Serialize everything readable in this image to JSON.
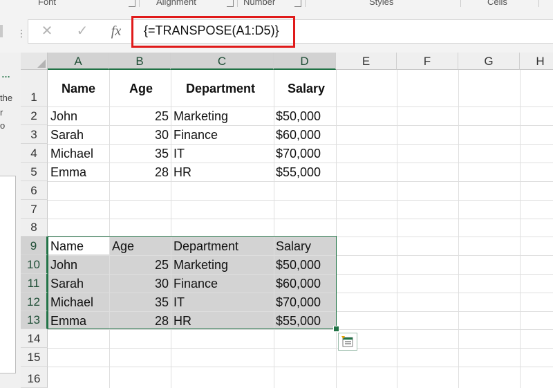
{
  "ribbon": {
    "groups": [
      "Font",
      "Alignment",
      "Number",
      "Styles",
      "Cells"
    ],
    "launcher_icon": "dialog-launcher-icon"
  },
  "formula_bar": {
    "cancel_icon": "✕",
    "enter_icon": "✓",
    "function_label": "fx",
    "formula": "{=TRANSPOSE(A1:D5)}",
    "highlight_color": "#e01a1a"
  },
  "left_pane": {
    "dots": "…",
    "text_lines": [
      "the",
      "r",
      "o"
    ]
  },
  "grid": {
    "columns": [
      "A",
      "B",
      "C",
      "D",
      "E",
      "F",
      "G",
      "H"
    ],
    "rows": [
      "1",
      "2",
      "3",
      "4",
      "5",
      "6",
      "7",
      "8",
      "9",
      "10",
      "11",
      "12",
      "13",
      "14",
      "15",
      "16"
    ],
    "table1": {
      "headers": [
        "Name",
        "Age",
        "Department",
        "Salary"
      ],
      "rows": [
        [
          "John",
          "25",
          "Marketing",
          "$50,000"
        ],
        [
          "Sarah",
          "30",
          "Finance",
          "$60,000"
        ],
        [
          "Michael",
          "35",
          "IT",
          "$70,000"
        ],
        [
          "Emma",
          "28",
          "HR",
          "$55,000"
        ]
      ]
    },
    "table2": {
      "headers": [
        "Name",
        "Age",
        "Department",
        "Salary"
      ],
      "rows": [
        [
          "John",
          "25",
          "Marketing",
          "$50,000"
        ],
        [
          "Sarah",
          "30",
          "Finance",
          "$60,000"
        ],
        [
          "Michael",
          "35",
          "IT",
          "$70,000"
        ],
        [
          "Emma",
          "28",
          "HR",
          "$55,000"
        ]
      ]
    },
    "selection_color": "#217346"
  }
}
